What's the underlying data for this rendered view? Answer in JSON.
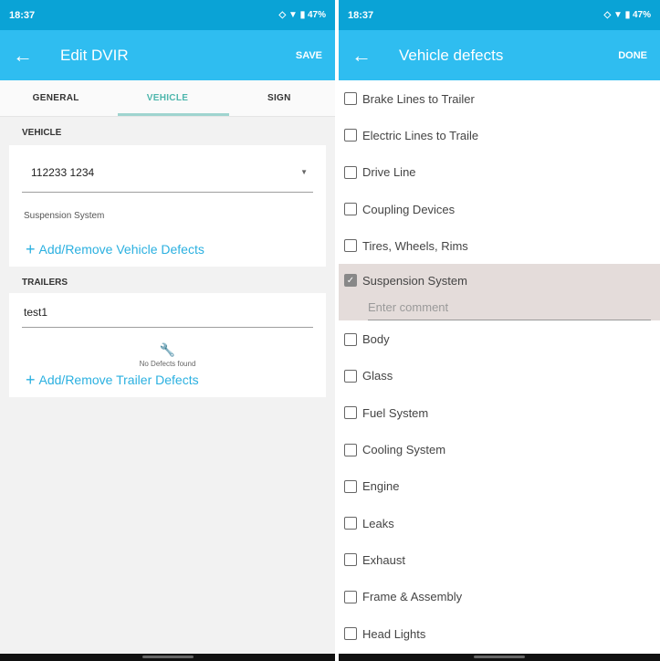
{
  "left": {
    "status": {
      "time": "18:37",
      "icons": "◇ ▼ ▮ 47%"
    },
    "appbar": {
      "title": "Edit DVIR",
      "action": "SAVE"
    },
    "tabs": [
      {
        "label": "GENERAL"
      },
      {
        "label": "VEHICLE"
      },
      {
        "label": "SIGN"
      }
    ],
    "vehicle": {
      "section_label": "VEHICLE",
      "selected": "112233 1234",
      "defect_text": "Suspension System",
      "add_label": "Add/Remove Vehicle Defects"
    },
    "trailers": {
      "section_label": "TRAILERS",
      "value": "test1",
      "no_defects": "No Defects found",
      "add_label": "Add/Remove Trailer Defects"
    }
  },
  "right": {
    "status": {
      "time": "18:37",
      "icons": "◇ ▼ ▮ 47%"
    },
    "appbar": {
      "title": "Vehicle defects",
      "action": "DONE"
    },
    "defects": [
      {
        "label": "Brake Lines to Trailer",
        "checked": false
      },
      {
        "label": "Electric Lines to Traile",
        "checked": false
      },
      {
        "label": "Drive Line",
        "checked": false
      },
      {
        "label": "Coupling Devices",
        "checked": false
      },
      {
        "label": "Tires, Wheels, Rims",
        "checked": false
      },
      {
        "label": "Suspension System",
        "checked": true
      },
      {
        "label": "Body",
        "checked": false
      },
      {
        "label": "Glass",
        "checked": false
      },
      {
        "label": "Fuel System",
        "checked": false
      },
      {
        "label": "Cooling System",
        "checked": false
      },
      {
        "label": "Engine",
        "checked": false
      },
      {
        "label": "Leaks",
        "checked": false
      },
      {
        "label": "Exhaust",
        "checked": false
      },
      {
        "label": "Frame & Assembly",
        "checked": false
      },
      {
        "label": "Head Lights",
        "checked": false
      }
    ],
    "comment_placeholder": "Enter comment"
  }
}
